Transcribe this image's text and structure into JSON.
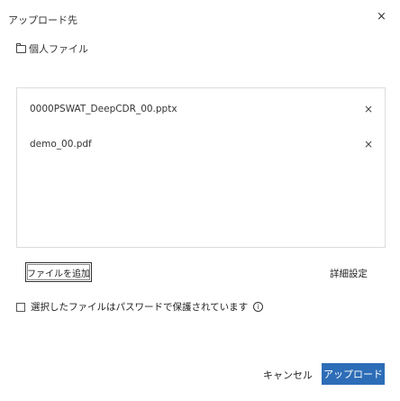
{
  "dialog": {
    "title": "アップロード先",
    "close_glyph": "×"
  },
  "destination": {
    "icon": "folder-icon",
    "label": "個人ファイル"
  },
  "files": [
    {
      "name": "0000PSWAT_DeepCDR_00.pptx",
      "remove_glyph": "×"
    },
    {
      "name": "demo_00.pdf",
      "remove_glyph": "×"
    }
  ],
  "actions": {
    "add_file_label": "ファイルを追加",
    "advanced_label": "詳細設定"
  },
  "password_option": {
    "checked": false,
    "label": "選択したファイルはパスワードで保護されています",
    "info_glyph": "i"
  },
  "footer": {
    "cancel_label": "キャンセル",
    "upload_label": "アップロード"
  },
  "colors": {
    "primary": "#2d6db7",
    "border": "#dcdcdc"
  }
}
